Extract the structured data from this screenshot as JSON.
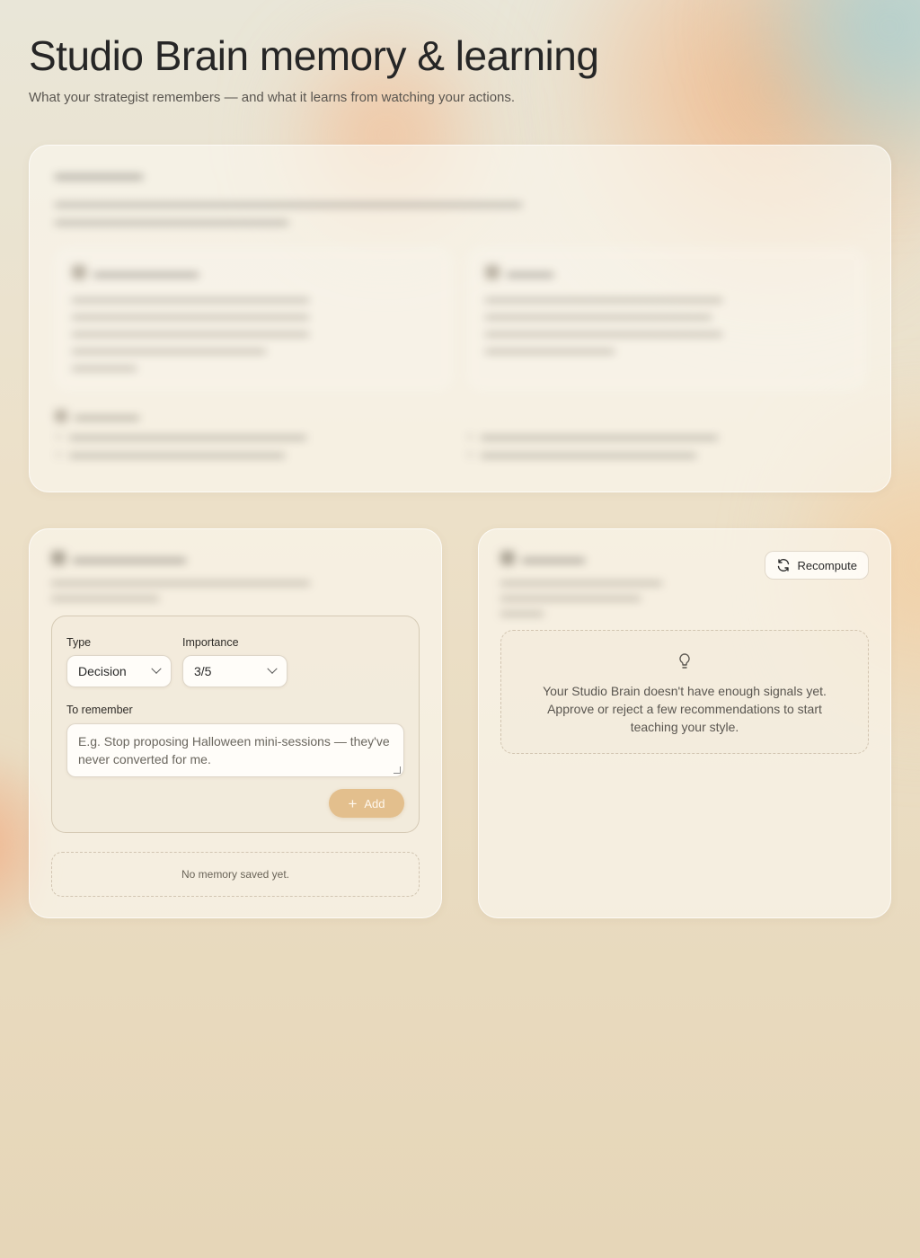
{
  "header": {
    "title": "Studio Brain memory & learning",
    "subtitle": "What your strategist remembers — and what it learns from watching your actions."
  },
  "memory": {
    "form": {
      "type_label": "Type",
      "type_value": "Decision",
      "importance_label": "Importance",
      "importance_value": "3/5",
      "remember_label": "To remember",
      "remember_placeholder": "E.g. Stop proposing Halloween mini-sessions — they've never converted for me.",
      "add_label": "Add"
    },
    "empty_text": "No memory saved yet."
  },
  "insights": {
    "recompute_label": "Recompute",
    "empty_text": "Your Studio Brain doesn't have enough signals yet. Approve or reject a few recommendations to start teaching your style."
  },
  "icons": {
    "recompute": "refresh-icon",
    "empty_insights": "lightbulb-icon",
    "add": "plus-icon",
    "select": "chevron-down-icon"
  },
  "colors": {
    "accent": "#e3bf8d",
    "text": "#262626",
    "muted": "#5a5650"
  }
}
